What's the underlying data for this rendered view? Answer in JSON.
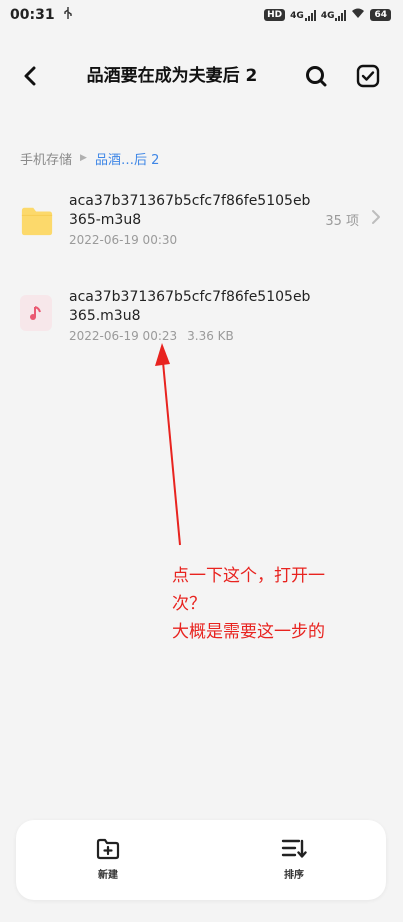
{
  "status_bar": {
    "time": "00:31",
    "usb_icon": "usb-icon",
    "hd_label": "HD",
    "net1_label": "4G",
    "net2_label": "4G",
    "battery": "64"
  },
  "header": {
    "title": "品酒要在成为夫妻后 2"
  },
  "breadcrumb": {
    "root": "手机存储",
    "current": "品酒…后 2"
  },
  "items": [
    {
      "type": "folder",
      "name": "aca37b371367b5cfc7f86fe5105eb365-m3u8",
      "date": "2022-06-19 00:30",
      "count": "35 项"
    },
    {
      "type": "file",
      "name": "aca37b371367b5cfc7f86fe5105eb365.m3u8",
      "date": "2022-06-19 00:23",
      "size": "3.36 KB"
    }
  ],
  "annotation": {
    "line1": "点一下这个，打开一",
    "line2": "次？",
    "line3": "大概是需要这一步的",
    "color": "#e8231f"
  },
  "bottom_bar": {
    "new_label": "新建",
    "sort_label": "排序"
  },
  "colors": {
    "accent": "#3e86e6",
    "folder": "#fcd96b",
    "file_bg": "#f7e7ea",
    "music_note": "#ea5a72"
  }
}
